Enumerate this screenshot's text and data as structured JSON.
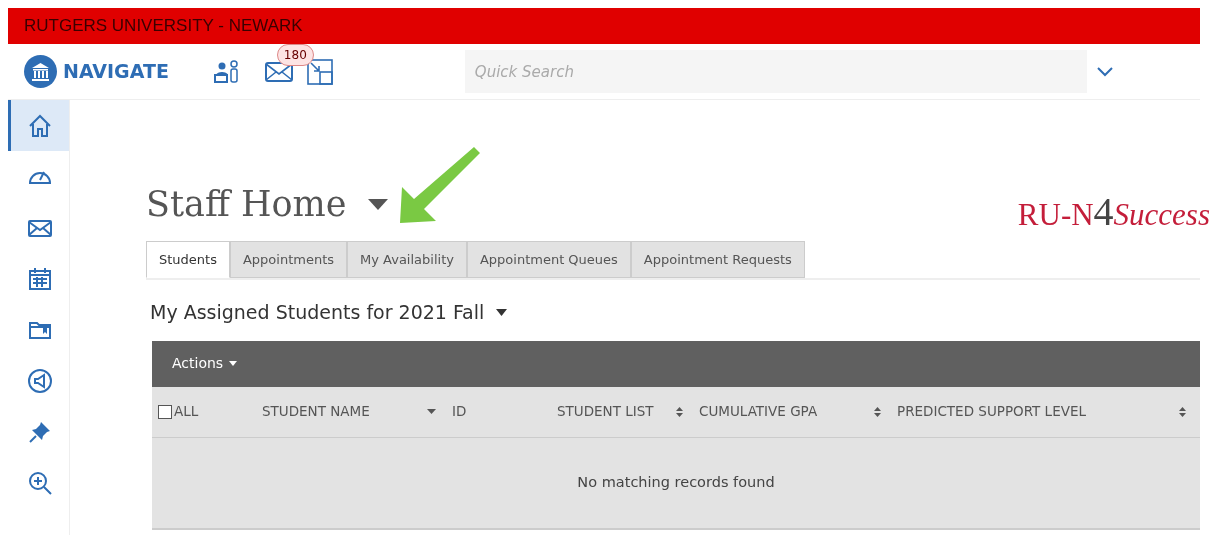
{
  "banner": {
    "title": "RUTGERS UNIVERSITY - NEWARK"
  },
  "header": {
    "brand": "NAVIGATE",
    "mail_count": "180",
    "search": {
      "placeholder": "Quick Search"
    }
  },
  "sidebar": {
    "items": [
      {
        "selected": true
      },
      {
        "selected": false
      },
      {
        "selected": false
      },
      {
        "selected": false
      },
      {
        "selected": false
      },
      {
        "selected": false
      },
      {
        "selected": false
      },
      {
        "selected": false
      }
    ]
  },
  "page": {
    "title": "Staff Home",
    "logo": [
      {
        "kind": "plain",
        "text": "RU-N"
      },
      {
        "kind": "digit",
        "text": "4"
      },
      {
        "kind": "italic",
        "text": "Success"
      }
    ]
  },
  "tabs": [
    {
      "label": "Students",
      "selected": true
    },
    {
      "label": "Appointments",
      "selected": false
    },
    {
      "label": "My Availability",
      "selected": false
    },
    {
      "label": "Appointment Queues",
      "selected": false
    },
    {
      "label": "Appointment Requests",
      "selected": false
    }
  ],
  "section": {
    "title": "My Assigned Students for 2021 Fall"
  },
  "table": {
    "actions": "Actions",
    "select_all": {
      "label": "ALL",
      "checked": false
    },
    "columns": [
      {
        "label": "STUDENT NAME",
        "kind": "sorted"
      },
      {
        "label": "ID",
        "kind": "plain"
      },
      {
        "label": "STUDENT LIST",
        "kind": "sortable"
      },
      {
        "label": "CUMULATIVE GPA",
        "kind": "sortable"
      },
      {
        "label": "PREDICTED SUPPORT LEVEL",
        "kind": "sortable"
      }
    ],
    "empty_message": "No matching records found"
  }
}
